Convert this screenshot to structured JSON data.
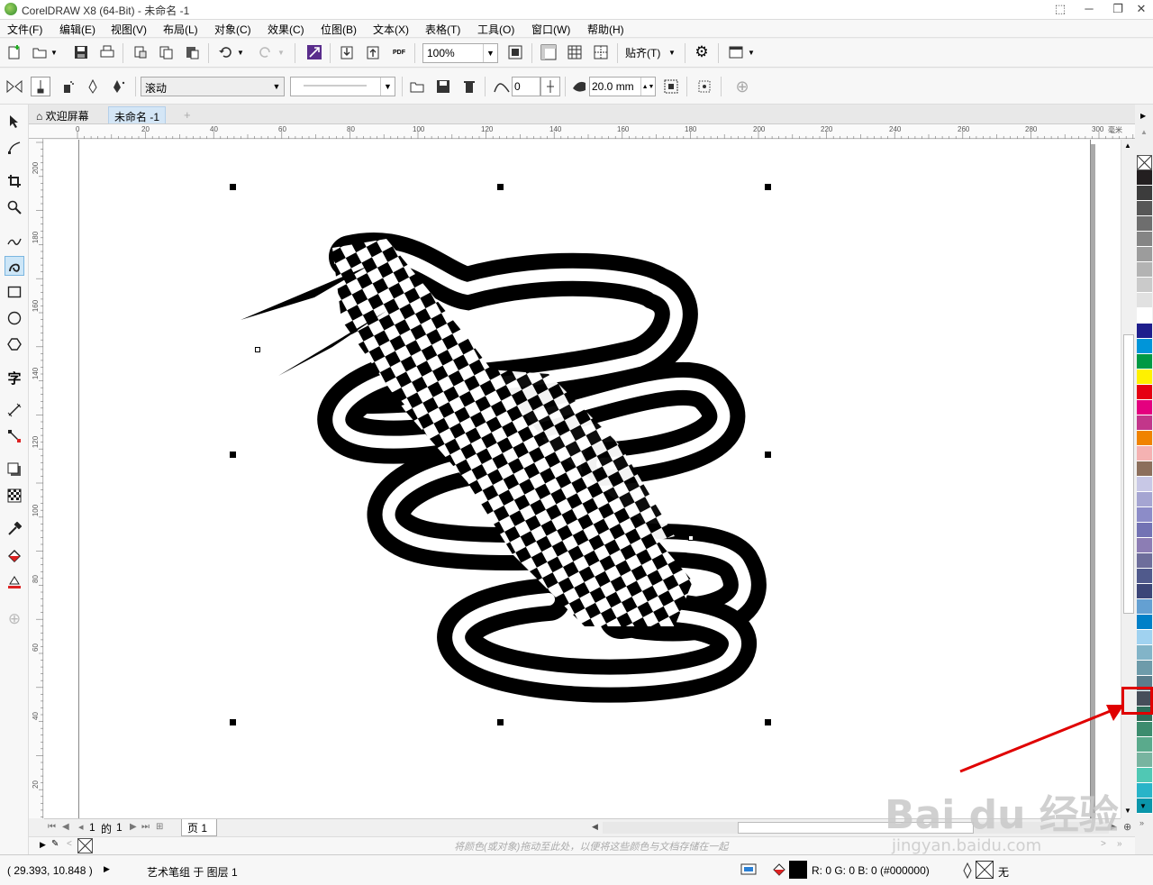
{
  "window": {
    "title": "CorelDRAW X8 (64-Bit) - 未命名 -1"
  },
  "menu": [
    "文件(F)",
    "编辑(E)",
    "视图(V)",
    "布局(L)",
    "对象(C)",
    "效果(C)",
    "位图(B)",
    "文本(X)",
    "表格(T)",
    "工具(O)",
    "窗口(W)",
    "帮助(H)"
  ],
  "standard_toolbar": {
    "zoom": "100%",
    "snap_label": "贴齐(T)"
  },
  "property_bar": {
    "brush_mode": "滚动",
    "smoothing": "0",
    "stroke_width": "20.0 mm"
  },
  "doc_tabs": [
    "欢迎屏幕",
    "未命名 -1"
  ],
  "hruler_labels": [
    "0",
    "20",
    "40",
    "60",
    "80",
    "100",
    "120",
    "140",
    "160",
    "180",
    "200",
    "220",
    "240",
    "260",
    "280",
    "300",
    "毫米"
  ],
  "vruler_labels": [
    "200",
    "180",
    "160",
    "140",
    "120",
    "100",
    "80",
    "60",
    "40",
    "20"
  ],
  "page_nav": {
    "current": "1",
    "of_label": "的",
    "total": "1",
    "page_tab": "页 1"
  },
  "doc_palette_hint": "将颜色(或对象)拖动至此处，以便将这些颜色与文档存储在一起",
  "status": {
    "coords": "( 29.393, 10.848 )",
    "selection": "艺术笔组 于 图层 1",
    "fill_color_text": "R: 0 G: 0 B: 0 (#000000)",
    "outline_text": "无"
  },
  "palette_colors": [
    "#231f20",
    "#3c3c3c",
    "#575757",
    "#6e6e6e",
    "#858585",
    "#9c9c9c",
    "#b3b3b3",
    "#cacaca",
    "#e1e1e1",
    "#ffffff",
    "#1e1e8c",
    "#0095d9",
    "#009944",
    "#fff100",
    "#e60012",
    "#e4007f",
    "#c2368a",
    "#f08300",
    "#f5b2b2",
    "#8c6f5c",
    "#c8c8e6",
    "#a5a5d2",
    "#8c8cc8",
    "#7373b4",
    "#8c7db4",
    "#6e6e9b",
    "#505a8c",
    "#3c4678",
    "#64a0d2",
    "#0080c8",
    "#a0d2f0",
    "#82b4c8",
    "#6e9baa",
    "#5a7d8c",
    "#464e5a",
    "#2e6e5a",
    "#3c8c6e",
    "#5aaa8c",
    "#78b4a0",
    "#50c8b4",
    "#28b4c8",
    "#0a96aa"
  ],
  "highlight": {
    "color": "#e00000"
  }
}
